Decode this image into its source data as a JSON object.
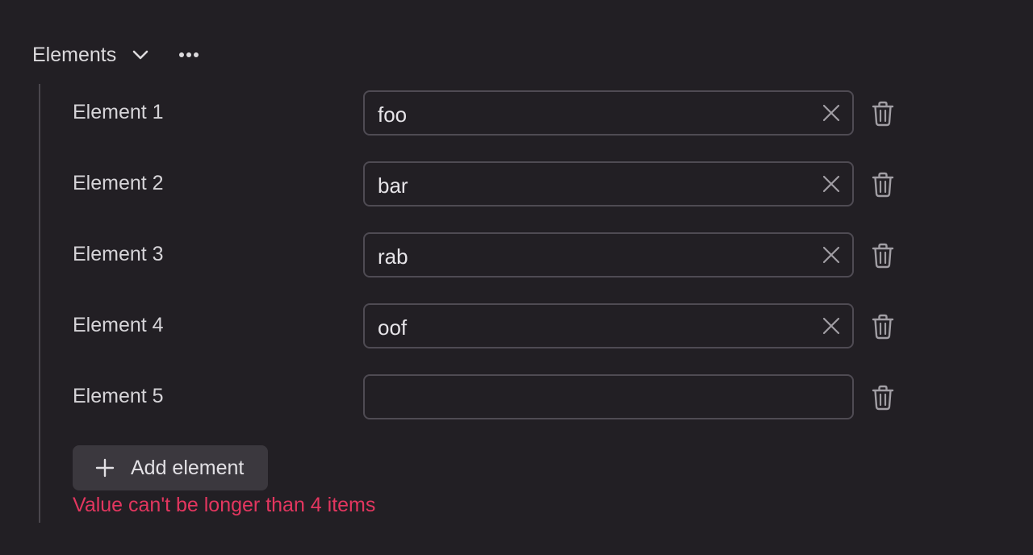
{
  "header": {
    "title": "Elements",
    "chevron_icon": "chevron-down-icon",
    "more_icon": "more-horizontal-icon"
  },
  "elements": [
    {
      "label": "Element 1",
      "value": "foo",
      "clearable": true
    },
    {
      "label": "Element 2",
      "value": "bar",
      "clearable": true
    },
    {
      "label": "Element 3",
      "value": "rab",
      "clearable": true
    },
    {
      "label": "Element 4",
      "value": "oof",
      "clearable": true
    },
    {
      "label": "Element 5",
      "value": "",
      "clearable": false
    }
  ],
  "add_button": {
    "label": "Add element",
    "icon": "plus-icon"
  },
  "error": {
    "message": "Value can't be longer than 4 items",
    "color": "#e3365f"
  },
  "colors": {
    "background": "#221f24",
    "field_border": "#4f4b53",
    "button_bg": "#3b383e",
    "icon": "#a19ea4"
  }
}
